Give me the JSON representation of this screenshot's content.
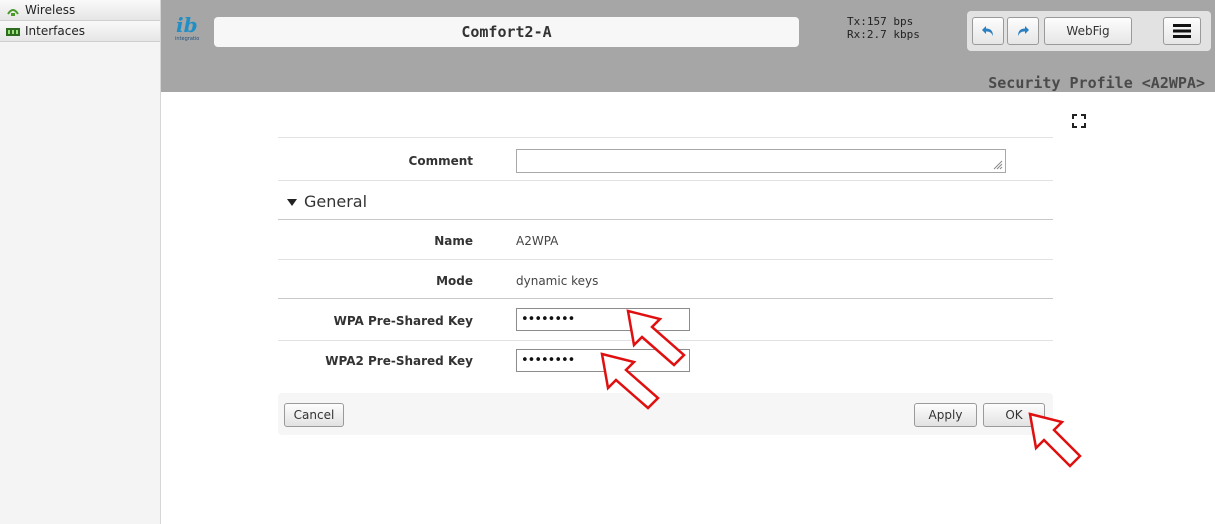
{
  "sidebar": {
    "items": [
      {
        "label": "Wireless",
        "icon": "wireless-icon"
      },
      {
        "label": "Interfaces",
        "icon": "interfaces-icon"
      }
    ]
  },
  "header": {
    "logo_text": "integratio",
    "title": "Comfort2-A",
    "traffic": {
      "tx": "Tx:157 bps",
      "rx": "Rx:2.7 kbps"
    },
    "webfig_label": "WebFig",
    "page_title": "Security Profile <A2WPA>"
  },
  "form": {
    "comment_label": "Comment",
    "comment_value": "",
    "section_title": "General",
    "name_label": "Name",
    "name_value": "A2WPA",
    "mode_label": "Mode",
    "mode_value": "dynamic keys",
    "wpa_label": "WPA Pre-Shared Key",
    "wpa_value": "••••••••",
    "wpa2_label": "WPA2 Pre-Shared Key",
    "wpa2_value": "••••••••"
  },
  "actions": {
    "cancel_label": "Cancel",
    "apply_label": "Apply",
    "ok_label": "OK"
  },
  "colors": {
    "header_bg": "#a6a6a6",
    "annotation_arrow": "#e01010",
    "logo_blue": "#1f8fc6"
  }
}
